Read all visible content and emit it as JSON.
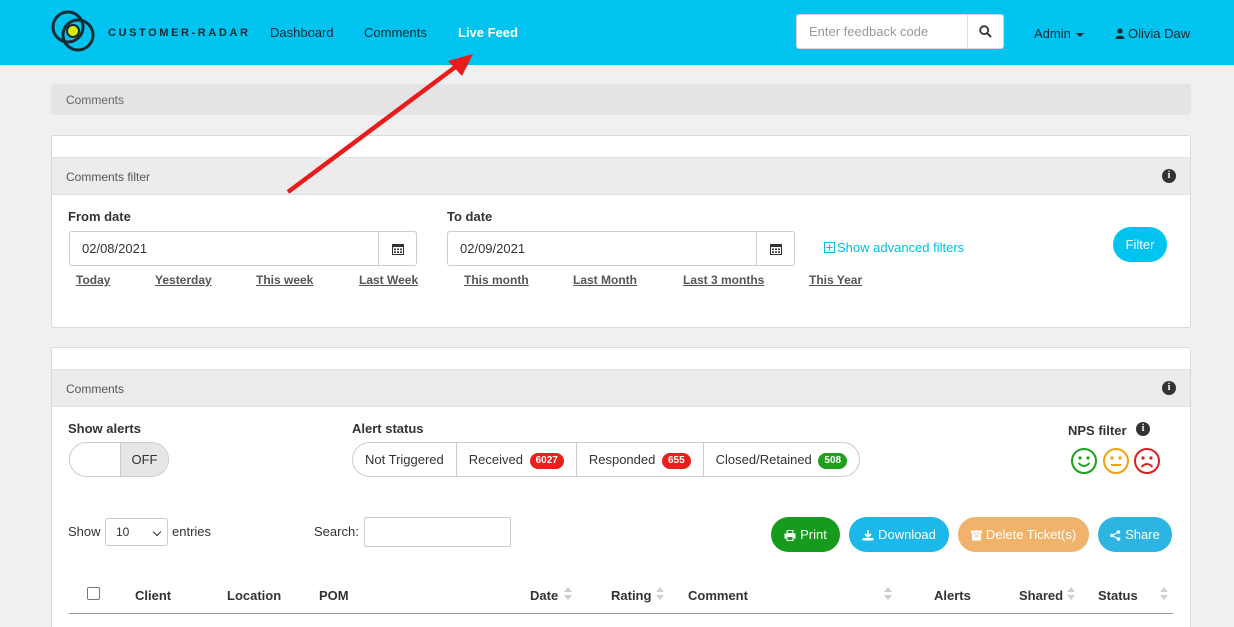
{
  "navbar": {
    "brand": "CUSTOMER-RADAR",
    "links": [
      "Dashboard",
      "Comments",
      "Live Feed"
    ],
    "active_link": "Live Feed",
    "search_placeholder": "Enter feedback code",
    "admin_label": "Admin",
    "user_name": "Olivia Daw",
    "colors": {
      "bar": "#00c3ef"
    }
  },
  "breadcrumb": "Comments",
  "filter_panel": {
    "heading": "Comments filter",
    "from_label": "From date",
    "from_value": "02/08/2021",
    "to_label": "To date",
    "to_value": "02/09/2021",
    "quick_ranges": [
      "Today",
      "Yesterday",
      "This week",
      "Last Week",
      "This month",
      "Last Month",
      "Last 3 months",
      "This Year"
    ],
    "advanced_link": "Show advanced filters",
    "filter_button": "Filter"
  },
  "comments_panel": {
    "heading": "Comments",
    "show_alerts_label": "Show alerts",
    "toggle_state": "OFF",
    "alert_status_label": "Alert status",
    "alert_buttons": [
      {
        "label": "Not Triggered",
        "count": "",
        "color": ""
      },
      {
        "label": "Received",
        "count": "6027",
        "color": "#e8201c"
      },
      {
        "label": "Responded",
        "count": "655",
        "color": "#e8201c"
      },
      {
        "label": "Closed/Retained",
        "count": "508",
        "color": "#21a01e"
      }
    ],
    "nps_label": "NPS filter",
    "nps_faces": [
      {
        "name": "happy-face-icon",
        "color": "#1ea01c"
      },
      {
        "name": "neutral-face-icon",
        "color": "#f0a30a"
      },
      {
        "name": "sad-face-icon",
        "color": "#d9201a"
      }
    ],
    "show_label": "Show",
    "entries_value": "10",
    "entries_label": "entries",
    "search_label": "Search:",
    "buttons": {
      "print": "Print",
      "download": "Download",
      "delete": "Delete Ticket(s)",
      "share": "Share"
    },
    "button_colors": {
      "print": "#179b1c",
      "download": "#1cb8e9",
      "delete": "#efb36b",
      "share": "#2db4e2"
    },
    "table_headers": [
      "Client",
      "Location",
      "POM",
      "Date",
      "Rating",
      "Comment",
      "Alerts",
      "Shared",
      "Status"
    ]
  }
}
